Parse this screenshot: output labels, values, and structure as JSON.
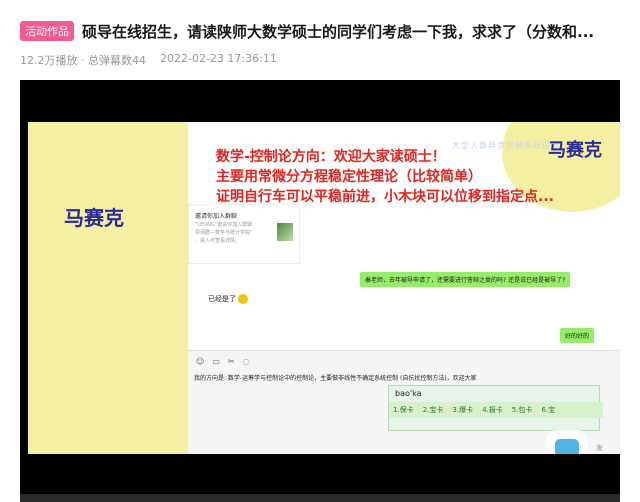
{
  "header": {
    "badge": "活动作品",
    "title": "硕导在线招生，请读陕师大数学硕士的同学们考虑一下我，求求了（分数和...",
    "plays": "12.2万播放 · 总弹幕数44",
    "date": "2022-02-23 17:36:11"
  },
  "slide": {
    "left_name": "马赛克",
    "right_name": "马赛克",
    "watermark": "大型人群异步控制系统设计",
    "lines": [
      "数学-控制论方向：欢迎大家读硕士！",
      "主要用常微分方程稳定性理论（比较简单）",
      "证明自行车可以平稳前进，小木块可以位移到指定点..."
    ]
  },
  "chat": {
    "card": {
      "title": "邀请你加入群聊",
      "line1": "\"LEONG\"邀请你加入群聊",
      "line2": "导师群—数学与统计学院\"",
      "line3": "，进入可查看详情。"
    },
    "green_messages": [
      "秦老师，去年被导申请了，还需要进行答辩之类的吗? 还是说已经是被导了?",
      "好的好的"
    ],
    "reply": "已经是了",
    "input_text": "我的方向是: 数学-运筹学与控制论中的控制论，主要做非线性不确定系统控制 (自抗扰控制方法)，欢迎大家",
    "ime_typed": "bao'ka",
    "ime_candidates": [
      "1.保卡",
      "2.宝卡",
      "3.爆卡",
      "4.报卡",
      "5.包卡",
      "6.宝"
    ],
    "send_label": "发"
  },
  "icons": {
    "tools": [
      "emoji-icon",
      "folder-icon",
      "scissors-icon",
      "chat-icon"
    ]
  }
}
